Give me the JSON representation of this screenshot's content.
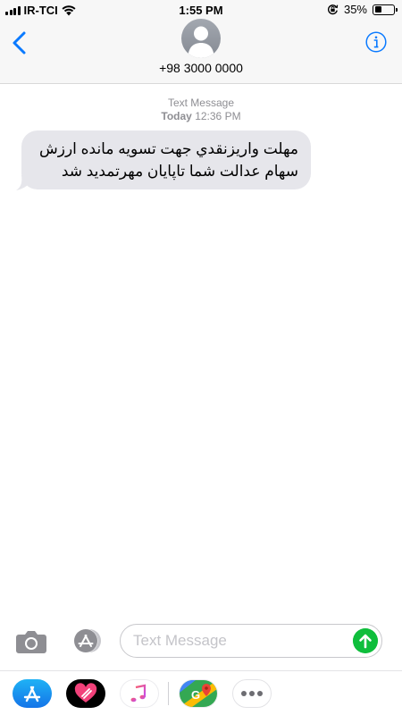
{
  "status_bar": {
    "carrier": "IR-TCI",
    "time": "1:55 PM",
    "battery_percent": "35%",
    "battery_level": 0.35
  },
  "header": {
    "back_icon": "chevron-left-icon",
    "contact": "+98 3000 0000",
    "info_icon": "info-icon"
  },
  "thread": {
    "service": "Text Message",
    "day": "Today",
    "time": "12:36 PM",
    "messages": [
      {
        "line1": "مهلت واریزنقدي جهت تسويه مانده ارزش",
        "line2": "سهام عدالت شما تاپایان مهرتمدید شد",
        "direction": "incoming"
      }
    ]
  },
  "composer": {
    "placeholder": "Text Message",
    "value": ""
  },
  "drawer": {
    "apps": [
      "app-store-icon",
      "digital-touch-icon",
      "music-icon",
      "maps-icon",
      "more-icon"
    ]
  },
  "colors": {
    "accent": "#0a7aff",
    "bubble": "#e6e6eb",
    "send": "#0fbe3c"
  }
}
